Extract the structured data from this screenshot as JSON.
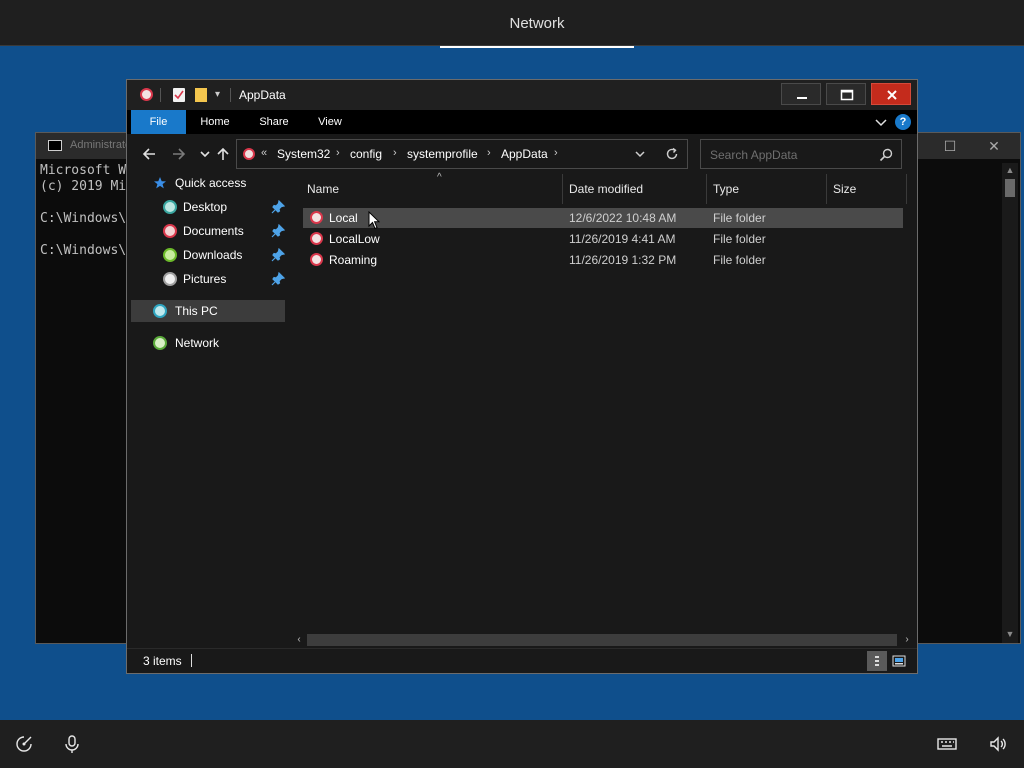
{
  "oobe": {
    "header_tab": "Network"
  },
  "cmd_window": {
    "title": "Administrator",
    "lines": [
      "Microsoft W",
      "(c) 2019 Mi",
      "",
      "C:\\Windows\\",
      "",
      "C:\\Windows\\"
    ]
  },
  "explorer": {
    "title": "AppData",
    "ribbon_tabs": [
      "File",
      "Home",
      "Share",
      "View"
    ],
    "breadcrumb_prefix": "«",
    "breadcrumbs": [
      "System32",
      "config",
      "systemprofile",
      "AppData"
    ],
    "search_placeholder": "Search AppData",
    "nav": {
      "quick_access": "Quick access",
      "desktop": "Desktop",
      "documents": "Documents",
      "downloads": "Downloads",
      "pictures": "Pictures",
      "this_pc": "This PC",
      "network": "Network"
    },
    "columns": {
      "name": "Name",
      "date": "Date modified",
      "type": "Type",
      "size": "Size"
    },
    "files": [
      {
        "name": "Local",
        "date": "12/6/2022 10:48 AM",
        "type": "File folder",
        "size": ""
      },
      {
        "name": "LocalLow",
        "date": "11/26/2019 4:41 AM",
        "type": "File folder",
        "size": ""
      },
      {
        "name": "Roaming",
        "date": "11/26/2019 1:32 PM",
        "type": "File folder",
        "size": ""
      }
    ],
    "status": "3 items",
    "colors": {
      "accent": "#1979ca",
      "close": "#c42b1c",
      "folder_icon": "#d9374b"
    }
  }
}
